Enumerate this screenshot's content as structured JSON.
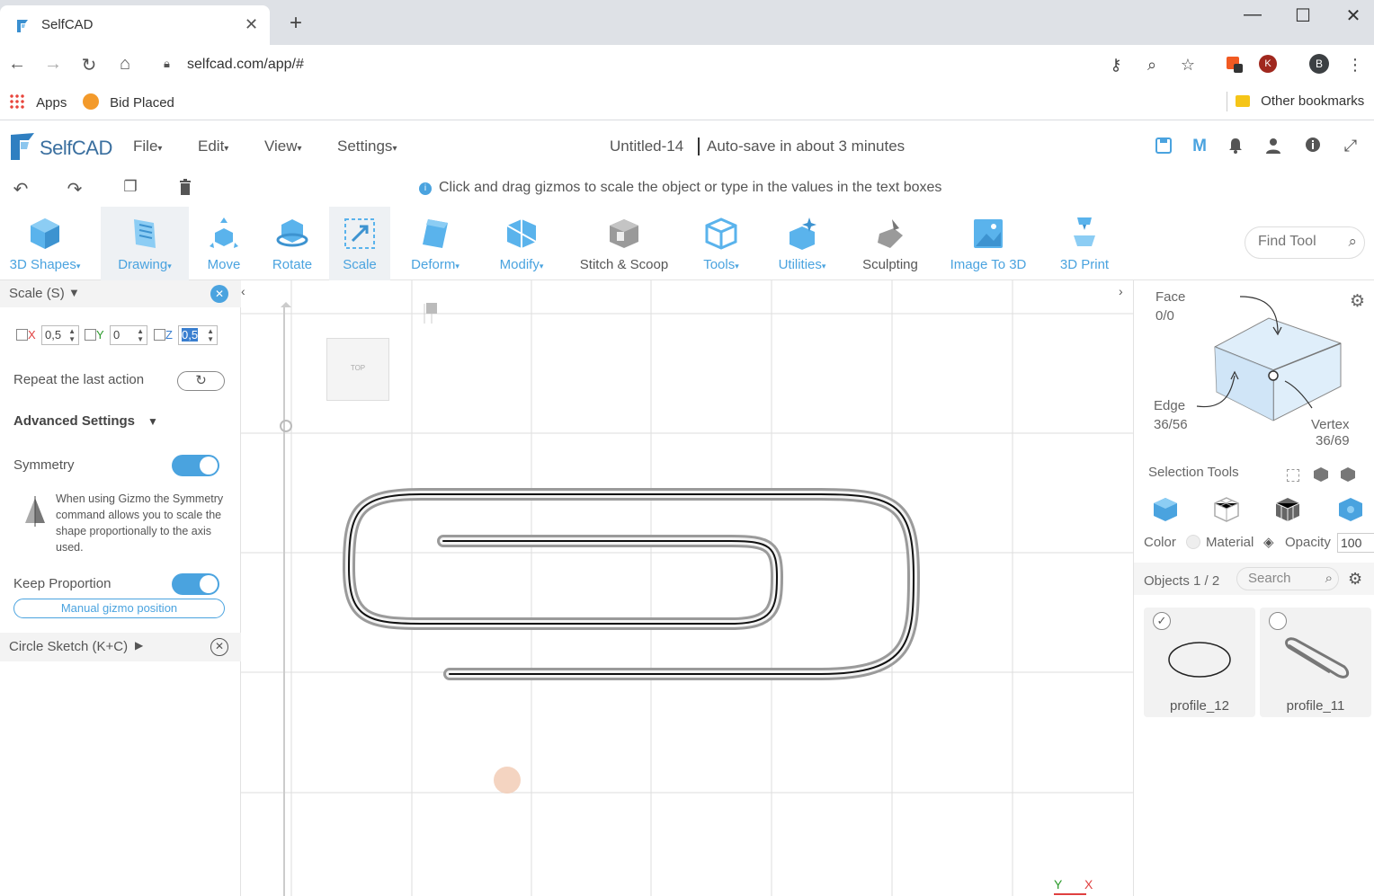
{
  "browser": {
    "tab_title": "SelfCAD",
    "url": "selfcad.com/app/#",
    "bookmarks": {
      "apps": "Apps",
      "bid_placed": "Bid Placed",
      "other": "Other bookmarks"
    },
    "profile_initial": "B",
    "ext_initial": "K"
  },
  "app": {
    "logo_text": "SelfCAD",
    "menus": [
      "File",
      "Edit",
      "View",
      "Settings"
    ],
    "doc_title": "Untitled-14",
    "autosave": "Auto-save in about 3 minutes",
    "hint": "Click and drag gizmos to scale the object or type in the values in the text boxes"
  },
  "toolbar": {
    "tools": [
      {
        "label": "3D Shapes",
        "dropdown": true
      },
      {
        "label": "Drawing",
        "dropdown": true
      },
      {
        "label": "Move",
        "dropdown": false
      },
      {
        "label": "Rotate",
        "dropdown": false
      },
      {
        "label": "Scale",
        "dropdown": false
      },
      {
        "label": "Deform",
        "dropdown": true
      },
      {
        "label": "Modify",
        "dropdown": true
      },
      {
        "label": "Stitch & Scoop",
        "dropdown": false
      },
      {
        "label": "Tools",
        "dropdown": true
      },
      {
        "label": "Utilities",
        "dropdown": true
      },
      {
        "label": "Sculpting",
        "dropdown": false
      },
      {
        "label": "Image To 3D",
        "dropdown": false
      },
      {
        "label": "3D Print",
        "dropdown": false
      }
    ],
    "find_tool_placeholder": "Find Tool"
  },
  "left_panel": {
    "title": "Scale (S)",
    "x_label": "X",
    "x_value": "0,5",
    "y_label": "Y",
    "y_value": "0",
    "z_label": "Z",
    "z_value": "0,5",
    "repeat_label": "Repeat the last action",
    "advanced_label": "Advanced Settings",
    "symmetry_label": "Symmetry",
    "symmetry_on": true,
    "symmetry_desc": "When using Gizmo the Symmetry command allows you to scale the shape proportionally to the axis used.",
    "keep_proportion_label": "Keep Proportion",
    "keep_proportion_on": true,
    "manual_gizmo_label": "Manual gizmo position",
    "circle_sketch_label": "Circle Sketch (K+C)"
  },
  "viewport": {
    "view_cube_label": "TOP",
    "axis_y": "Y",
    "axis_x": "X"
  },
  "right_panel": {
    "face_label": "Face",
    "face_count": "0/0",
    "edge_label": "Edge",
    "edge_count": "36/56",
    "vertex_label": "Vertex",
    "vertex_count": "36/69",
    "selection_tools_label": "Selection Tools",
    "color_label": "Color",
    "material_label": "Material",
    "opacity_label": "Opacity",
    "opacity_value": "100",
    "objects_label": "Objects 1 / 2",
    "search_placeholder": "Search",
    "objects": [
      {
        "name": "profile_12",
        "checked": true
      },
      {
        "name": "profile_11",
        "checked": false
      }
    ]
  },
  "colors": {
    "accent": "#4aa3df",
    "panel_bg": "#f3f3f3"
  }
}
